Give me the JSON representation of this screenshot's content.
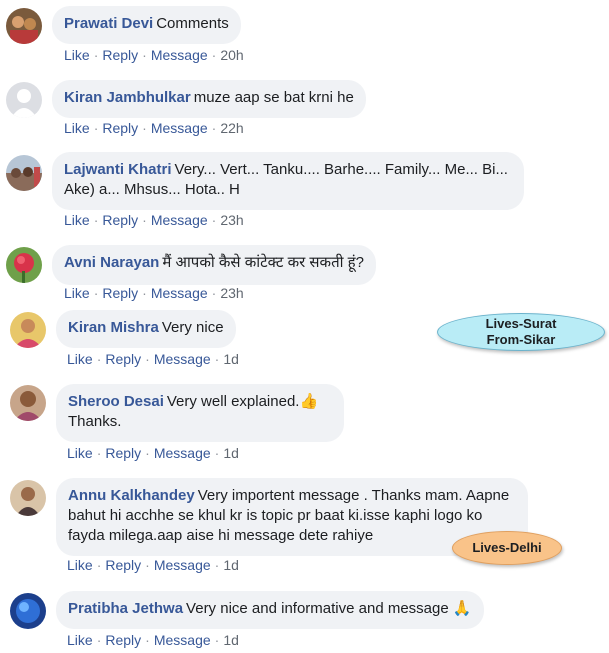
{
  "comments": [
    {
      "author": "Prawati Devi",
      "text": "Comments",
      "actions": {
        "like": "Like",
        "reply": "Reply",
        "message": "Message",
        "time": "20h"
      }
    },
    {
      "author": "Kiran Jambhulkar",
      "text": "muze aap se bat krni he",
      "actions": {
        "like": "Like",
        "reply": "Reply",
        "message": "Message",
        "time": "22h"
      }
    },
    {
      "author": "Lajwanti Khatri",
      "text": "Very... Vert... Tanku.... Barhe.... Family... Me... Bi... Ake) a... Mhsus... Hota.. H",
      "actions": {
        "like": "Like",
        "reply": "Reply",
        "message": "Message",
        "time": "23h"
      }
    },
    {
      "author": "Avni Narayan",
      "text": "मैं आपको कैसे कांटेक्ट कर सकती हूं?",
      "actions": {
        "like": "Like",
        "reply": "Reply",
        "message": "Message",
        "time": "23h"
      }
    },
    {
      "author": "Kiran Mishra",
      "text": "Very nice",
      "actions": {
        "like": "Like",
        "reply": "Reply",
        "message": "Message",
        "time": "1d"
      }
    },
    {
      "author": "Sheroo Desai",
      "text": "Very well explained.👍 Thanks.",
      "actions": {
        "like": "Like",
        "reply": "Reply",
        "message": "Message",
        "time": "1d"
      }
    },
    {
      "author": "Annu Kalkhandey",
      "text": "Very importent message . Thanks mam. Aapne bahut hi acchhe se khul kr is topic pr baat ki.isse kaphi logo ko fayda milega.aap aise hi message dete rahiye",
      "actions": {
        "like": "Like",
        "reply": "Reply",
        "message": "Message",
        "time": "1d"
      }
    },
    {
      "author": "Pratibha Jethwa",
      "text": "Very nice and informative and message 🙏",
      "actions": {
        "like": "Like",
        "reply": "Reply",
        "message": "Message",
        "time": "1d"
      }
    }
  ],
  "annotations": {
    "surat": {
      "line1": "Lives-Surat",
      "line2": "From-Sikar",
      "color": "#b9ecf6"
    },
    "delhi": {
      "text": "Lives-Delhi",
      "color": "#f9c389"
    }
  },
  "colors": {
    "link": "#385898",
    "bubble": "#f0f2f5",
    "meta": "#606770"
  }
}
